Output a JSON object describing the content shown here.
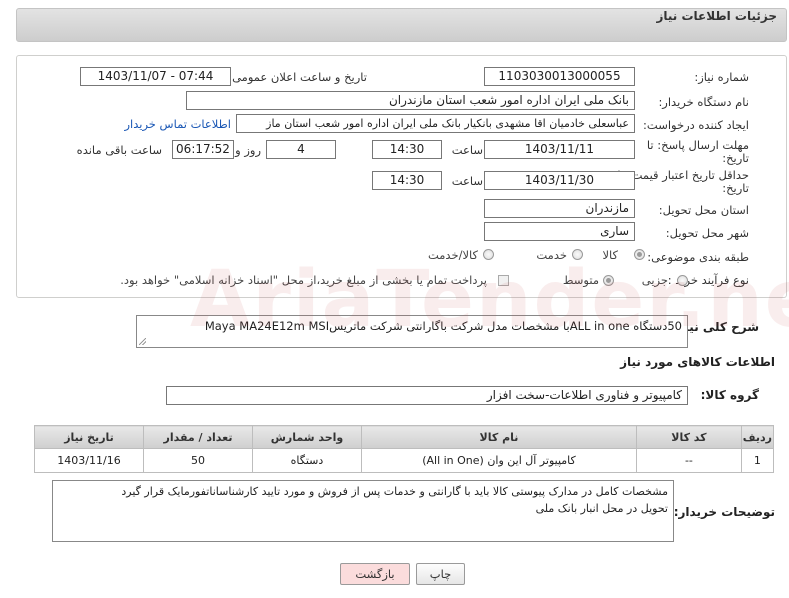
{
  "header": {
    "title": "جزئیات اطلاعات نیاز"
  },
  "fields": {
    "need_number_label": "شماره نیاز:",
    "need_number": "1103030013000055",
    "announce_label": "تاریخ و ساعت اعلان عمومی:",
    "announce_value": "1403/11/07 - 07:44",
    "buyer_label": "نام دستگاه خریدار:",
    "buyer_value": "بانک ملی ایران اداره امور شعب استان مازندران",
    "requester_label": "ایجاد کننده درخواست:",
    "requester_value": "عباسعلی خادمیان اقا مشهدی بانکیار بانک ملی ایران اداره امور شعب استان ماز",
    "contact_link": "اطلاعات تماس خریدار",
    "deadline_label_1": "مهلت ارسال پاسخ: تا",
    "deadline_label_2": "تاریخ:",
    "deadline_date": "1403/11/11",
    "time_label": "ساعت",
    "deadline_time": "14:30",
    "days_value": "4",
    "days_label": "روز و",
    "remaining_time": "06:17:52",
    "remaining_label": "ساعت باقی مانده",
    "validity_label_1": "حداقل تاریخ اعتبار قیمت: تا",
    "validity_label_2": "تاریخ:",
    "validity_date": "1403/11/30",
    "validity_time": "14:30",
    "province_label": "استان محل تحویل:",
    "province_value": "مازندران",
    "city_label": "شهر محل تحویل:",
    "city_value": "ساری",
    "category_label": "طبقه بندی موضوعی:",
    "category_options": [
      "کالا",
      "خدمت",
      "کالا/خدمت"
    ],
    "process_label": "نوع فرآیند خرید :",
    "process_options": [
      "جزیی",
      "متوسط"
    ],
    "payment_text": "پرداخت تمام یا بخشی از مبلغ خرید،از محل \"اسناد خزانه اسلامی\" خواهد بود."
  },
  "summary": {
    "label": "شرح کلی نیاز:",
    "value": "50دستگاه ALL in oneبا مشخصات مدل شرکت باگارانتی شرکت ماتریسMaya MA24E12m MSI"
  },
  "goods": {
    "section_title": "اطلاعات کالاهای مورد نیاز",
    "group_label": "گروه کالا:",
    "group_value": "کامپیوتر و فناوری اطلاعات-سخت افزار",
    "table": {
      "headers": [
        "ردیف",
        "کد کالا",
        "نام کالا",
        "واحد شمارش",
        "تعداد / مقدار",
        "تاریخ نیاز"
      ],
      "rows": [
        [
          "1",
          "--",
          "کامپیوتر آل این وان (All in One)",
          "دستگاه",
          "50",
          "1403/11/16"
        ]
      ]
    }
  },
  "buyer_notes": {
    "label": "توضیحات خریدار:",
    "line1": "مشخصات کامل در مدارک پیوستی  کالا باید با گارانتی و خدمات پس از فروش و مورد تایید کارشناساناتفورمایک قرار گیرد",
    "line2": "تحویل در محل انبار بانک ملی"
  },
  "buttons": {
    "print": "چاپ",
    "back": "بازگشت"
  },
  "watermark": "AriaTender.net",
  "colors": {
    "back_button": "#fbdcdc",
    "link": "#1a57b5"
  }
}
